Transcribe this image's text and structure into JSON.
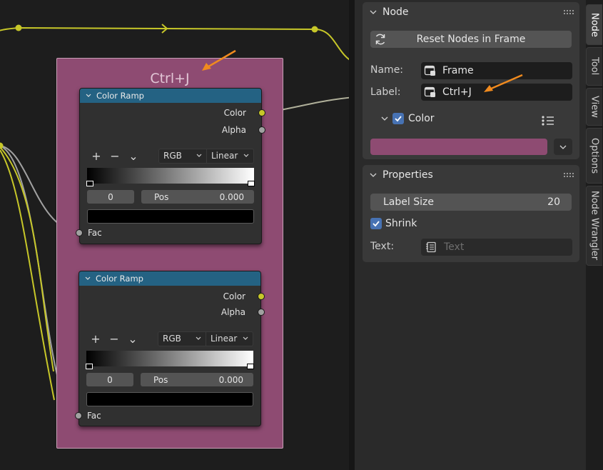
{
  "editor": {
    "frame": {
      "label": "Ctrl+J",
      "color": "#8e4b72"
    },
    "nodes": [
      {
        "title": "Color Ramp",
        "outputs": [
          "Color",
          "Alpha"
        ],
        "color_mode": "RGB",
        "interpolation": "Linear",
        "stop_index": "0",
        "pos_label": "Pos",
        "pos_value": "0.000",
        "input_label": "Fac"
      },
      {
        "title": "Color Ramp",
        "outputs": [
          "Color",
          "Alpha"
        ],
        "color_mode": "RGB",
        "interpolation": "Linear",
        "stop_index": "0",
        "pos_label": "Pos",
        "pos_value": "0.000",
        "input_label": "Fac"
      }
    ],
    "ramp_tools": {
      "add": "+",
      "remove": "−",
      "menu": "⌄"
    },
    "colors": {
      "header": "#246283",
      "socket_color": "#c7c729",
      "socket_float": "#a1a1a1",
      "annotation_arrow": "#f08a1e"
    }
  },
  "panel": {
    "node_section": {
      "title": "Node",
      "reset_button": "Reset Nodes in Frame",
      "name_label": "Name:",
      "name_value": "Frame",
      "label_label": "Label:",
      "label_value": "Ctrl+J",
      "color_toggle_label": "Color",
      "color_checked": true,
      "color_value": "#8e4b72"
    },
    "properties_section": {
      "title": "Properties",
      "label_size_label": "Label Size",
      "label_size_value": "20",
      "shrink_label": "Shrink",
      "shrink_checked": true,
      "text_label": "Text:",
      "text_placeholder": "Text"
    }
  },
  "tabs": [
    "Node",
    "Tool",
    "View",
    "Options",
    "Node Wrangler"
  ],
  "active_tab": "Node"
}
